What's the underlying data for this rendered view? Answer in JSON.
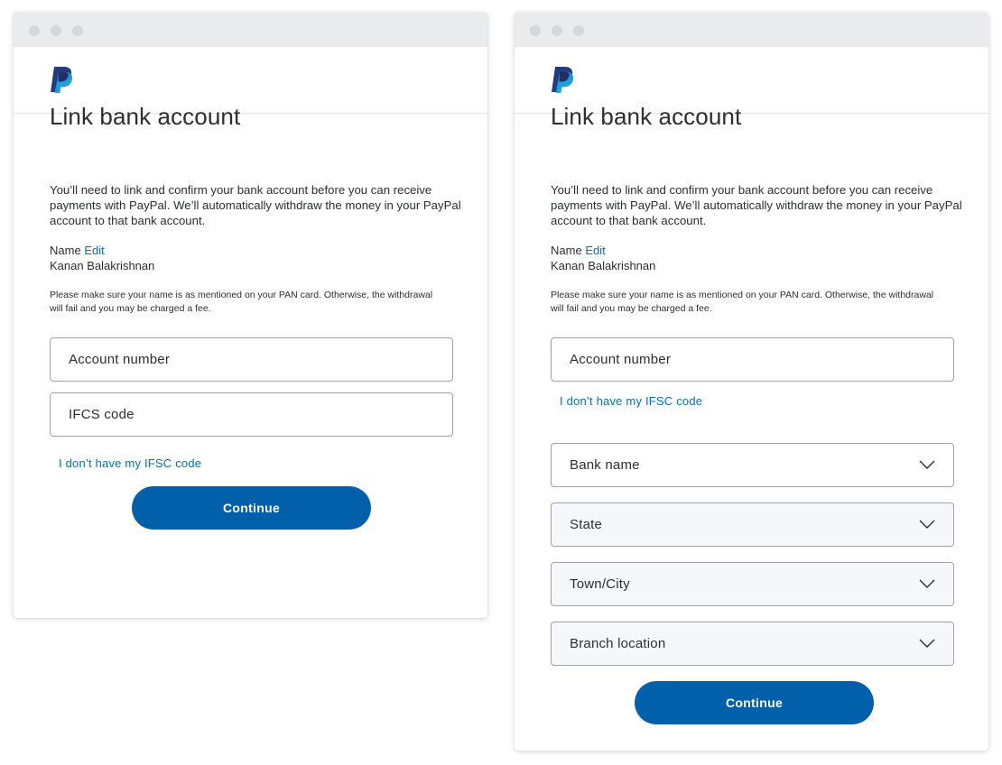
{
  "left_window": {
    "title": "Link bank account",
    "intro": "You’ll need to link and confirm your bank account before you can receive payments with PayPal. We’ll automatically withdraw the money in your PayPal account to that bank account.",
    "name_label": "Name",
    "edit_link": "Edit",
    "name_value": "Kanan Balakrishnan",
    "note": "Please make sure your name is as mentioned on your PAN card. Otherwise, the withdrawal will fail and you may be charged a fee.",
    "account_number_placeholder": "Account number",
    "ifsc_placeholder": "IFCS code",
    "no_ifsc_link": "I don’t have my IFSC code",
    "continue_label": "Continue"
  },
  "right_window": {
    "title": "Link bank account",
    "intro": "You’ll need to link and confirm your bank account before you can receive payments with PayPal. We’ll automatically withdraw the money in your PayPal account to that bank account.",
    "name_label": "Name",
    "edit_link": "Edit",
    "name_value": "Kanan Balakrishnan",
    "note": "Please make sure your name is as mentioned on your PAN card. Otherwise, the withdrawal will fail and you may be charged a fee.",
    "account_number_placeholder": "Account number",
    "no_ifsc_link": "I don’t have my IFSC code",
    "bank_name_label": "Bank name",
    "state_label": "State",
    "town_city_label": "Town/City",
    "branch_location_label": "Branch location",
    "continue_label": "Continue"
  },
  "icons": {
    "logo": "paypal-logo-icon",
    "dropdown": "chevron-down-icon"
  },
  "colors": {
    "brand_blue": "#0160a9",
    "link_blue": "#0070ba",
    "logo_dark": "#253b80",
    "logo_light": "#179bd7"
  }
}
